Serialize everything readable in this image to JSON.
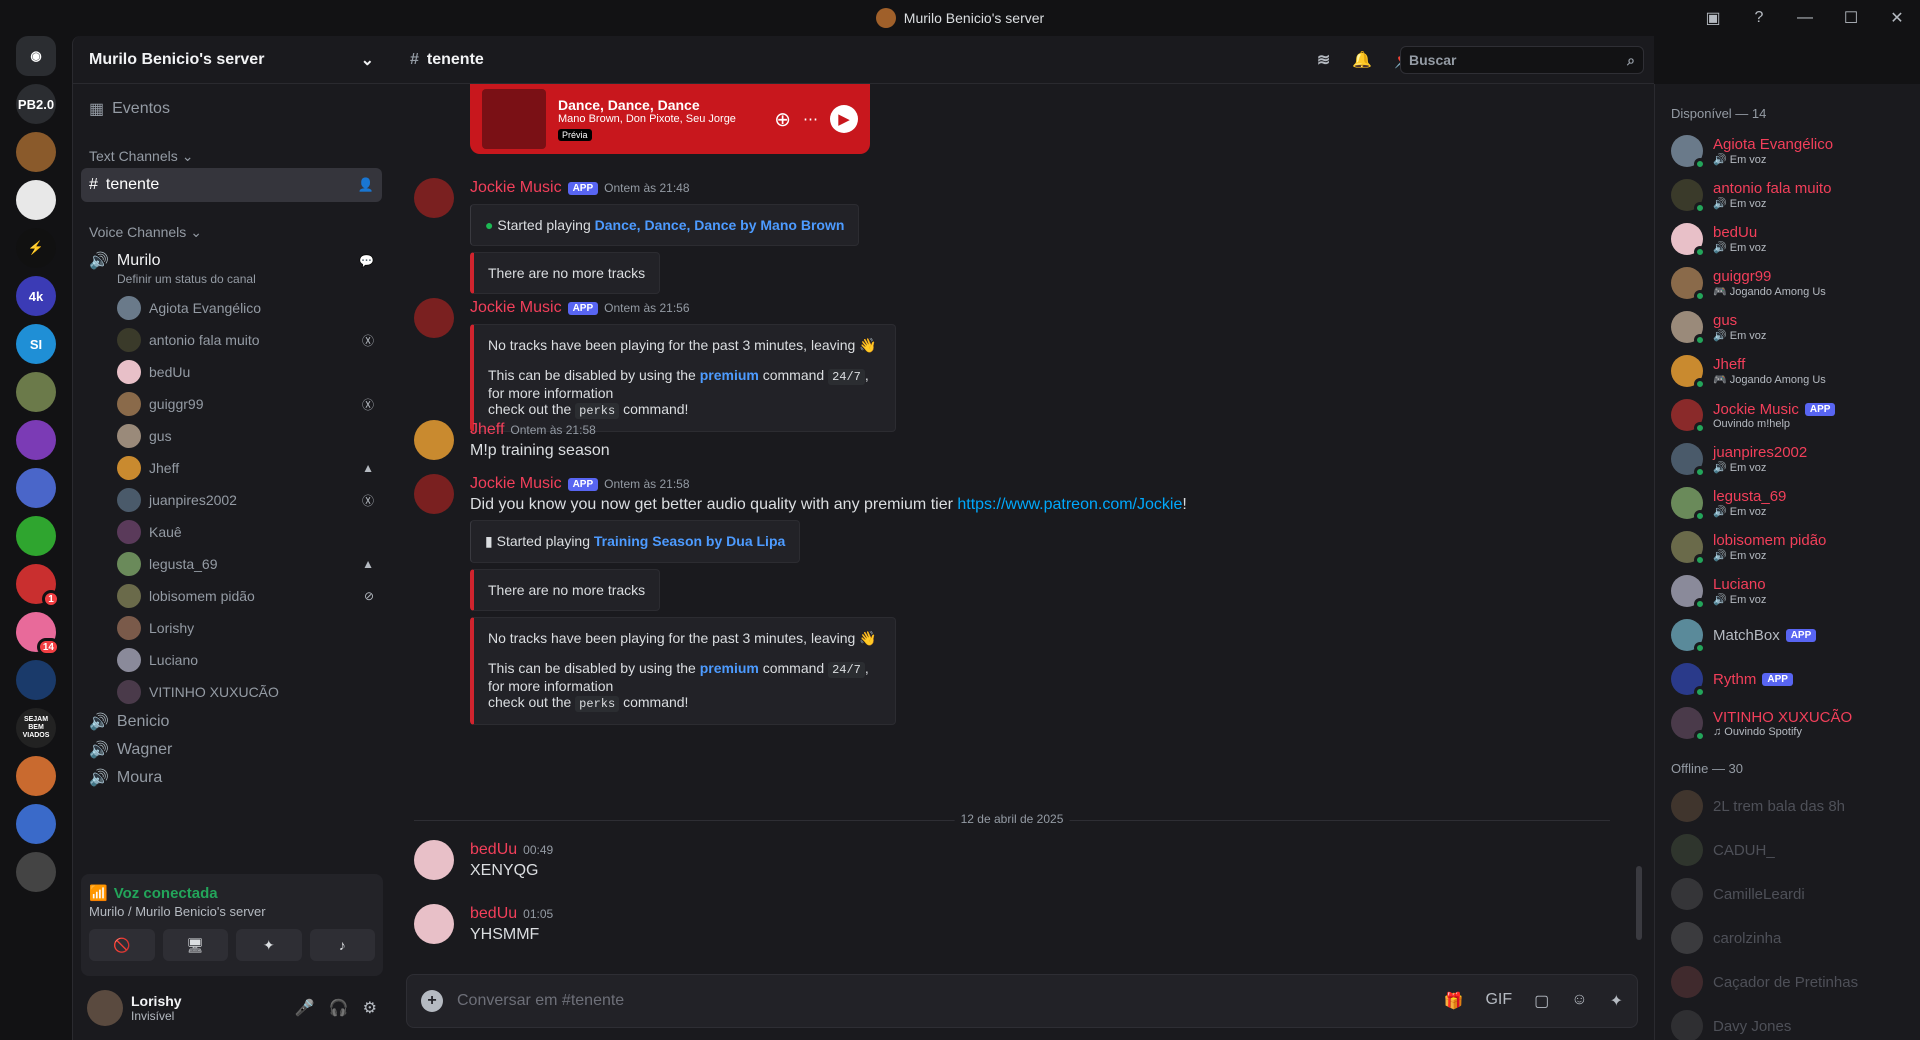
{
  "titlebar": {
    "title": "Murilo Benicio's server"
  },
  "guilds": [
    {
      "label": "PB2.0",
      "color": "#2b2d31",
      "badge": ""
    },
    {
      "label": "",
      "color": "#8a5a2b",
      "badge": ""
    },
    {
      "label": "",
      "color": "#e8e8e8",
      "badge": ""
    },
    {
      "label": "⚡",
      "color": "#111",
      "badge": ""
    },
    {
      "label": "4k",
      "color": "#3b3bb5",
      "badge": ""
    },
    {
      "label": "SI",
      "color": "#1f8fd6",
      "badge": ""
    },
    {
      "label": "",
      "color": "#6b7a4a",
      "badge": ""
    },
    {
      "label": "",
      "color": "#7b3bb5",
      "badge": ""
    },
    {
      "label": "",
      "color": "#4a66c9",
      "badge": ""
    },
    {
      "label": "",
      "color": "#2fa52f",
      "badge": ""
    },
    {
      "label": "",
      "color": "#c92f2f",
      "badge": "1"
    },
    {
      "label": "",
      "color": "#e86a9a",
      "badge": "14"
    },
    {
      "label": "",
      "color": "#1a3a6a",
      "badge": ""
    },
    {
      "label": "SEJAM BEM VIADOS",
      "color": "#222",
      "badge": ""
    },
    {
      "label": "",
      "color": "#c96a2f",
      "badge": ""
    },
    {
      "label": "",
      "color": "#3a6ac9",
      "badge": ""
    },
    {
      "label": "",
      "color": "#444",
      "badge": ""
    }
  ],
  "sidebar": {
    "server_name": "Murilo Benicio's server",
    "events_label": "Eventos",
    "text_category": "Text Channels",
    "text_channel": "tenente",
    "voice_category": "Voice Channels",
    "voice_channel": "Murilo",
    "voice_status": "Definir um status do canal",
    "voice_users": [
      {
        "name": "Agiota Evangélico",
        "icon": "",
        "color": "#6a7a8a"
      },
      {
        "name": "antonio fala muito",
        "icon": "xbox",
        "color": "#3a3a2a"
      },
      {
        "name": "bedUu",
        "icon": "",
        "color": "#e8c0c8"
      },
      {
        "name": "guiggr99",
        "icon": "xbox",
        "color": "#8a6a4a"
      },
      {
        "name": "gus",
        "icon": "",
        "color": "#9a8a7a"
      },
      {
        "name": "Jheff",
        "icon": "ps",
        "color": "#c98a2f"
      },
      {
        "name": "juanpires2002",
        "icon": "xbox",
        "color": "#4a5a6a"
      },
      {
        "name": "Kauê",
        "icon": "",
        "color": "#5a3a5a"
      },
      {
        "name": "legusta_69",
        "icon": "ps",
        "color": "#6a8a5a"
      },
      {
        "name": "lobisomem pidão",
        "icon": "deaf",
        "color": "#6a6a4a"
      },
      {
        "name": "Lorishy",
        "icon": "",
        "color": "#7a5a4a"
      },
      {
        "name": "Luciano",
        "icon": "",
        "color": "#8a8a9a"
      },
      {
        "name": "VITINHO XUXUCÃO",
        "icon": "",
        "color": "#4a3a4a"
      }
    ],
    "other_voice": [
      "Benicio",
      "Wagner",
      "Moura"
    ]
  },
  "voice_panel": {
    "status": "Voz conectada",
    "location": "Murilo / Murilo Benicio's server"
  },
  "user_panel": {
    "name": "Lorishy",
    "status": "Invisível"
  },
  "channel": {
    "name": "tenente",
    "search_placeholder": "Buscar",
    "composer_placeholder": "Conversar em #tenente"
  },
  "spotify": {
    "title": "Dance, Dance, Dance",
    "artists": "Mano Brown, Don Pixote, Seu Jorge",
    "preview": "Prévia"
  },
  "messages": [
    {
      "author": "Jockie Music",
      "app": "APP",
      "ts": "Ontem às 21:48",
      "embed1_prefix": "Started playing ",
      "embed1_link": "Dance, Dance, Dance by Mano Brown",
      "embed2": "There are no more tracks"
    },
    {
      "author": "Jockie Music",
      "app": "APP",
      "ts": "Ontem às 21:56",
      "line1": "No tracks have been playing for the past 3 minutes, leaving 👋",
      "line2a": "This can be disabled by using the ",
      "line2b": "premium",
      "line2c": " command ",
      "code1": "24/7",
      "line2d": ", for more information",
      "line3a": "check out the ",
      "code2": "perks",
      "line3b": " command!"
    },
    {
      "author": "Jheff",
      "ts": "Ontem às 21:58",
      "text": "M!p training season"
    },
    {
      "author": "Jockie Music",
      "app": "APP",
      "ts": "Ontem às 21:58",
      "text": "Did you know you now get better audio quality with any premium tier ",
      "link": "https://www.patreon.com/Jockie",
      "text_end": "!",
      "embed1_prefix": "Started playing ",
      "embed1_link": "Training Season by Dua Lipa",
      "embed2": "There are no more tracks",
      "line1": "No tracks have been playing for the past 3 minutes, leaving 👋",
      "line2a": "This can be disabled by using the ",
      "line2b": "premium",
      "line2c": " command ",
      "code1": "24/7",
      "line2d": ", for more information",
      "line3a": "check out the ",
      "code2": "perks",
      "line3b": " command!"
    },
    {
      "author": "bedUu",
      "ts": "00:49",
      "text": "XENYQG"
    },
    {
      "author": "bedUu",
      "ts": "01:05",
      "text": "YHSMMF"
    }
  ],
  "date_divider": "12 de abril de 2025",
  "members": {
    "online_header": "Disponível — 14",
    "online": [
      {
        "name": "Agiota Evangélico",
        "status": "🔊 Em voz",
        "app": "",
        "color": "#6a7a8a"
      },
      {
        "name": "antonio fala muito",
        "status": "🔊 Em voz",
        "app": "",
        "color": "#3a3a2a"
      },
      {
        "name": "bedUu",
        "status": "🔊 Em voz",
        "app": "",
        "color": "#e8c0c8"
      },
      {
        "name": "guiggr99",
        "status": "🎮 Jogando Among Us",
        "app": "",
        "color": "#8a6a4a"
      },
      {
        "name": "gus",
        "status": "🔊 Em voz",
        "app": "",
        "color": "#9a8a7a"
      },
      {
        "name": "Jheff",
        "status": "🎮 Jogando Among Us",
        "app": "",
        "color": "#c98a2f"
      },
      {
        "name": "Jockie Music",
        "status": "Ouvindo m!help",
        "app": "APP",
        "color": "#8a2a2a"
      },
      {
        "name": "juanpires2002",
        "status": "🔊 Em voz",
        "app": "",
        "color": "#4a5a6a"
      },
      {
        "name": "legusta_69",
        "status": "🔊 Em voz",
        "app": "",
        "color": "#6a8a5a"
      },
      {
        "name": "lobisomem pidão",
        "status": "🔊 Em voz",
        "app": "",
        "color": "#6a6a4a"
      },
      {
        "name": "Luciano",
        "status": "🔊 Em voz",
        "app": "",
        "color": "#8a8a9a"
      },
      {
        "name": "MatchBox",
        "status": "",
        "app": "APP",
        "color": "#5a8a9a"
      },
      {
        "name": "Rythm",
        "status": "",
        "app": "APP",
        "color": "#2a3a8a"
      },
      {
        "name": "VITINHO XUXUCÃO",
        "status": "♫ Ouvindo Spotify",
        "app": "",
        "color": "#4a3a4a"
      }
    ],
    "offline_header": "Offline — 30",
    "offline": [
      {
        "name": "2L trem bala das 8h",
        "color": "#8a6a4a"
      },
      {
        "name": "CADUH_",
        "color": "#5a6a4a"
      },
      {
        "name": "CamilleLeardi",
        "color": "#6a6a6a"
      },
      {
        "name": "carolzinha",
        "color": "#7a7a7a"
      },
      {
        "name": "Caçador de Pretinhas",
        "color": "#8a4a4a"
      },
      {
        "name": "Davy Jones",
        "color": "#5a5a5a"
      }
    ]
  }
}
